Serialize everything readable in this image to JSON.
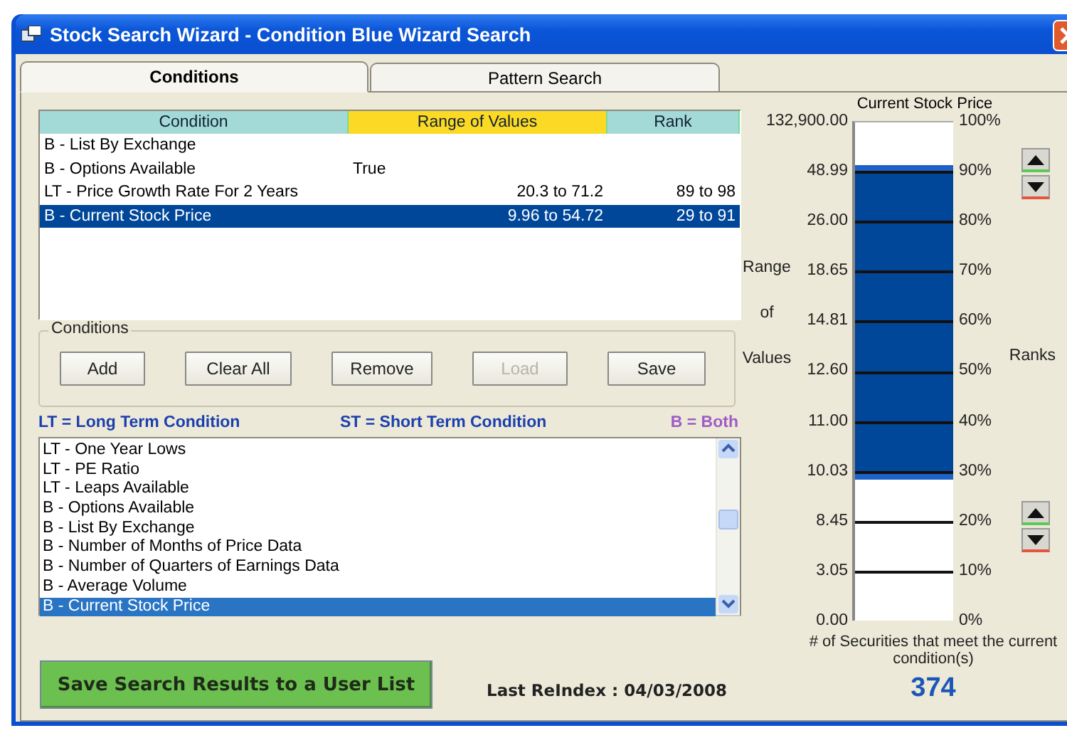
{
  "window": {
    "title": "Stock Search Wizard - Condition Blue Wizard Search"
  },
  "tabs": [
    {
      "label": "Conditions",
      "selected": true
    },
    {
      "label": "Pattern Search",
      "selected": false
    }
  ],
  "conditions_table": {
    "columns": [
      {
        "label": "Condition",
        "selected": false
      },
      {
        "label": "Range of Values",
        "selected": true
      },
      {
        "label": "Rank",
        "selected": false
      }
    ],
    "rows": [
      {
        "condition": "B - List By Exchange",
        "selected": false
      },
      {
        "condition": "B - Options Available",
        "range": "True",
        "selected": false
      },
      {
        "condition": "LT - Price Growth Rate For 2 Years",
        "range": "20.3 to 71.2",
        "rank": "89 to 98",
        "selected": false
      },
      {
        "condition": "B - Current Stock Price",
        "range": "9.96 to 54.72",
        "rank": "29 to 91",
        "selected": true
      }
    ]
  },
  "conditions_group": {
    "title": "Conditions",
    "buttons": [
      {
        "label": "Add",
        "disabled": false
      },
      {
        "label": "Clear All",
        "disabled": false
      },
      {
        "label": "Remove",
        "disabled": false
      },
      {
        "label": "Load",
        "disabled": true
      },
      {
        "label": "Save",
        "disabled": false
      }
    ]
  },
  "legend": [
    {
      "text": "LT = Long Term Condition",
      "color": "#1c3fae"
    },
    {
      "text": "ST = Short Term Condition",
      "color": "#1c3fae"
    },
    {
      "text": "B = Both",
      "color": "#a05cc4"
    }
  ],
  "condition_list": [
    {
      "label": "LT - One Year Lows",
      "selected": false
    },
    {
      "label": "LT - PE Ratio",
      "selected": false
    },
    {
      "label": "LT - Leaps Available",
      "selected": false
    },
    {
      "label": "B - Options Available",
      "selected": false
    },
    {
      "label": "B - List By Exchange",
      "selected": false
    },
    {
      "label": "B - Number of Months of Price Data",
      "selected": false
    },
    {
      "label": "B - Number of Quarters of Earnings Data",
      "selected": false
    },
    {
      "label": "B - Average Volume",
      "selected": false
    },
    {
      "label": "B - Current Stock Price",
      "selected": true
    }
  ],
  "save_button": "Save Search Results to a User List",
  "last_reindex": "Last ReIndex : 04/03/2008",
  "range_chart": {
    "title": "Current Stock Price",
    "axis_title": "Range of Values",
    "ranks_title": "Ranks",
    "value_labels": [
      "132,900.00",
      "48.99",
      "26.00",
      "18.65",
      "14.81",
      "12.60",
      "11.00",
      "10.03",
      "8.45",
      "3.05",
      "0.00"
    ],
    "rank_labels": [
      "100%",
      "90%",
      "80%",
      "70%",
      "60%",
      "50%",
      "40%",
      "30%",
      "20%",
      "10%",
      "0%"
    ],
    "high": {
      "level": 0.91
    },
    "low": {
      "level": 0.29
    },
    "caption": "# of Securities that meet the current condition(s)",
    "count": "374"
  }
}
